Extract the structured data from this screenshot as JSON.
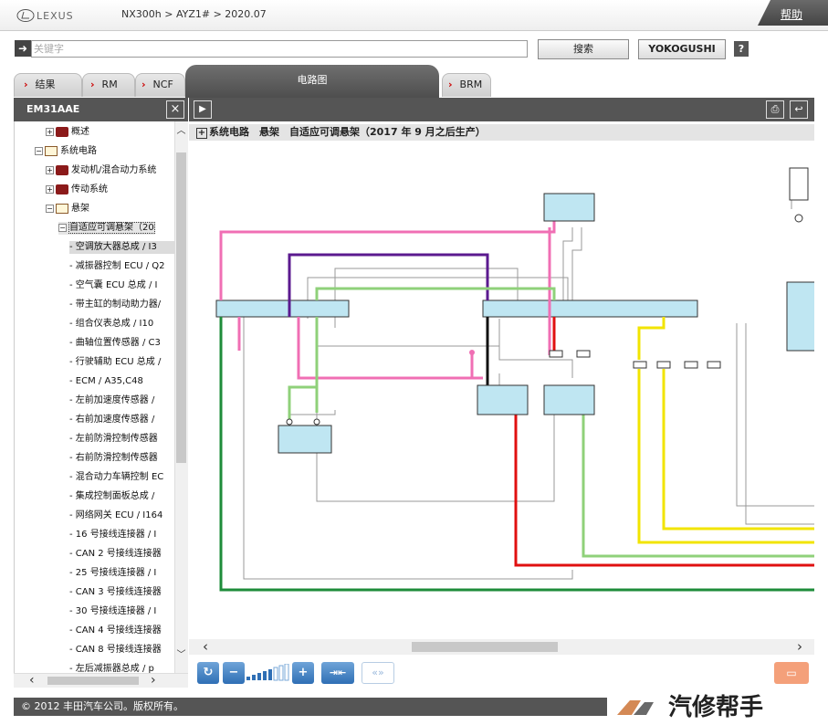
{
  "header": {
    "breadcrumb": "NX300h > AYZ1# > 2020.07",
    "help_label": "帮助",
    "logo_text": "LEXUS"
  },
  "search": {
    "placeholder": "关键字",
    "search_label": "搜索",
    "yokogushi_label": "YOKOGUSHI",
    "question_label": "?"
  },
  "tabs": [
    {
      "label": "结果",
      "arrow": "›"
    },
    {
      "label": "RM",
      "arrow": "›"
    },
    {
      "label": "NCF",
      "arrow": "›"
    },
    {
      "label": "电路图"
    },
    {
      "label": "BRM",
      "arrow": "›"
    }
  ],
  "left_panel": {
    "title": "EM31AAE",
    "close_label": "×",
    "tree": [
      {
        "label": "概述",
        "level": 1,
        "toggle": "+",
        "book": "red"
      },
      {
        "label": "系统电路",
        "level": 0,
        "toggle": "−",
        "book": "open"
      },
      {
        "label": "发动机/混合动力系统",
        "level": 1,
        "toggle": "+",
        "book": "red"
      },
      {
        "label": "传动系统",
        "level": 1,
        "toggle": "+",
        "book": "red"
      },
      {
        "label": "悬架",
        "level": 1,
        "toggle": "−",
        "book": "open"
      },
      {
        "label": "自适应可调悬架（20",
        "level": 2,
        "toggle": "−",
        "selected": true
      },
      {
        "label": "- 空调放大器总成 / I3",
        "level": 3,
        "highlight": true
      },
      {
        "label": "- 减振器控制 ECU / Q2",
        "level": 3
      },
      {
        "label": "- 空气囊 ECU 总成 / I",
        "level": 3
      },
      {
        "label": "- 带主缸的制动助力器/",
        "level": 3
      },
      {
        "label": "- 组合仪表总成 / I10",
        "level": 3
      },
      {
        "label": "- 曲轴位置传感器 / C3",
        "level": 3
      },
      {
        "label": "- 行驶辅助 ECU 总成 /",
        "level": 3
      },
      {
        "label": "- ECM / A35,C48",
        "level": 3
      },
      {
        "label": "- 左前加速度传感器 /",
        "level": 3
      },
      {
        "label": "- 右前加速度传感器 /",
        "level": 3
      },
      {
        "label": "- 左前防滑控制传感器",
        "level": 3
      },
      {
        "label": "- 右前防滑控制传感器",
        "level": 3
      },
      {
        "label": "- 混合动力车辆控制 EC",
        "level": 3
      },
      {
        "label": "- 集成控制面板总成 /",
        "level": 3
      },
      {
        "label": "- 网络网关 ECU / I164",
        "level": 3
      },
      {
        "label": "- 16 号接线连接器 / I",
        "level": 3
      },
      {
        "label": "- CAN 2 号接线连接器",
        "level": 3
      },
      {
        "label": "- 25 号接线连接器 / I",
        "level": 3
      },
      {
        "label": "- CAN 3 号接线连接器",
        "level": 3
      },
      {
        "label": "- 30 号接线连接器 / I",
        "level": 3
      },
      {
        "label": "- CAN 4 号接线连接器",
        "level": 3
      },
      {
        "label": "- CAN 8 号接线连接器",
        "level": 3
      },
      {
        "label": "- 左后减振器总成 / p",
        "level": 3
      }
    ]
  },
  "diagram": {
    "title": "系统电路　悬架　自适应可调悬架（2017 年 9 月之后生产）",
    "expand_label": "+"
  },
  "footer": {
    "copyright": "© 2012 丰田汽车公司。版权所有。",
    "watermark": "汽修帮手"
  },
  "colors": {
    "pink": "#f06fb4",
    "purple": "#5b1a8f",
    "green": "#8fd17a",
    "dark_green": "#1e8c3a",
    "red": "#e01010",
    "yellow": "#f2e400",
    "connector": "#bfe6f2"
  }
}
